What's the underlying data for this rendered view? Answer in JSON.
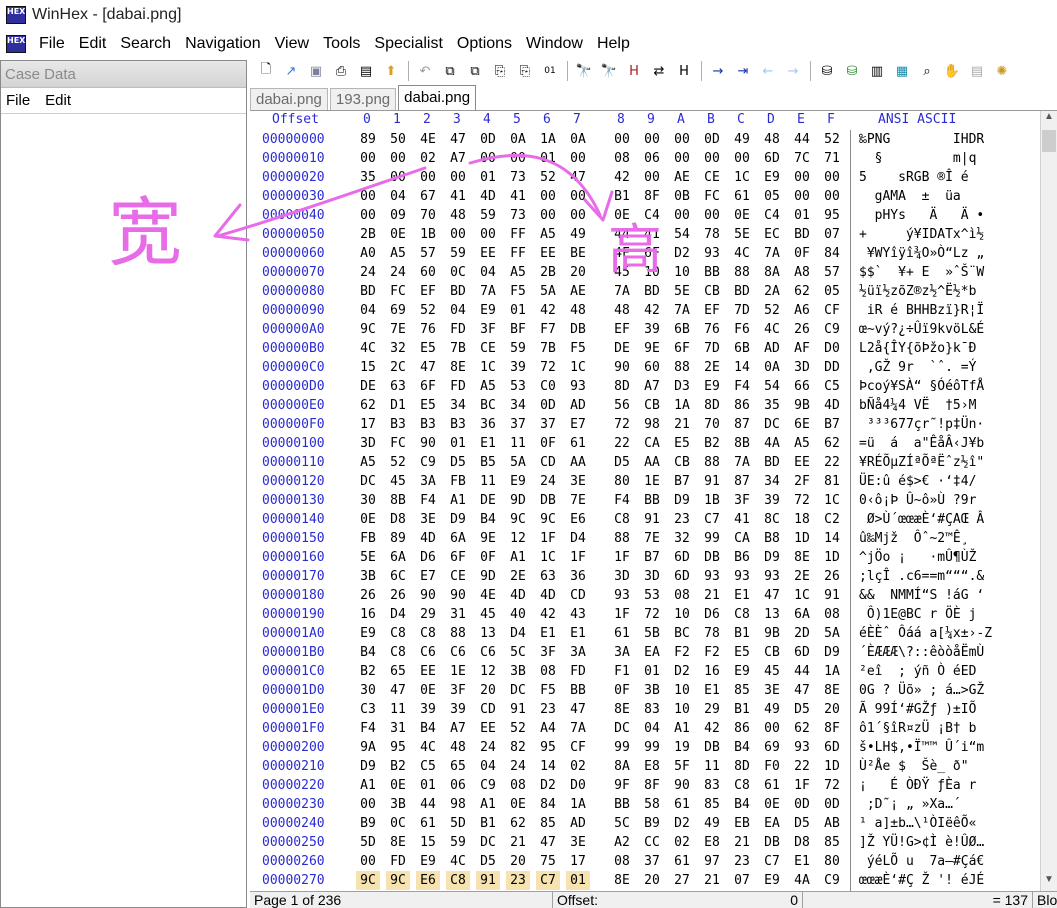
{
  "window": {
    "title": "WinHex - [dabai.png]",
    "logo": "HEX"
  },
  "menu": [
    "File",
    "Edit",
    "Search",
    "Navigation",
    "View",
    "Tools",
    "Specialist",
    "Options",
    "Window",
    "Help"
  ],
  "case_panel": {
    "header": "Case Data",
    "menu": [
      "File",
      "Edit"
    ]
  },
  "toolbar_icons": [
    "new-file-icon",
    "open-icon",
    "save-icon",
    "print-icon",
    "properties-icon",
    "export-icon",
    "undo-icon",
    "copy-icon",
    "paste-icon",
    "search-icon",
    "replace-icon",
    "goto-icon",
    "arrow-right-icon",
    "back-icon",
    "forward-icon",
    "disk-icon",
    "calculator-icon",
    "settings-icon"
  ],
  "tabs": [
    {
      "label": "dabai.png",
      "active": false
    },
    {
      "label": "193.png",
      "active": false
    },
    {
      "label": "dabai.png",
      "active": true
    }
  ],
  "hex": {
    "offset_header": "Offset",
    "col_headers": [
      "0",
      "1",
      "2",
      "3",
      "4",
      "5",
      "6",
      "7",
      "8",
      "9",
      "A",
      "B",
      "C",
      "D",
      "E",
      "F"
    ],
    "ascii_header": "ANSI ASCII",
    "offsets": [
      "00000000",
      "00000010",
      "00000020",
      "00000030",
      "00000040",
      "00000050",
      "00000060",
      "00000070",
      "00000080",
      "00000090",
      "000000A0",
      "000000B0",
      "000000C0",
      "000000D0",
      "000000E0",
      "000000F0",
      "00000100",
      "00000110",
      "00000120",
      "00000130",
      "00000140",
      "00000150",
      "00000160",
      "00000170",
      "00000180",
      "00000190",
      "000001A0",
      "000001B0",
      "000001C0",
      "000001D0",
      "000001E0",
      "000001F0",
      "00000200",
      "00000210",
      "00000220",
      "00000230",
      "00000240",
      "00000250",
      "00000260",
      "00000270"
    ],
    "rows": [
      "89 50 4E 47 0D 0A 1A 0A 00 00 00 0D 49 48 44 52",
      "00 00 02 A7 00 00 01 00 08 06 00 00 00 6D 7C 71",
      "35 00 00 00 01 73 52 47 42 00 AE CE 1C E9 00 00",
      "00 04 67 41 4D 41 00 00 B1 8F 0B FC 61 05 00 00",
      "00 09 70 48 59 73 00 00 0E C4 00 00 0E C4 01 95",
      "2B 0E 1B 00 00 FF A5 49 44 41 54 78 5E EC BD 07",
      "A0 A5 57 59 EE FF EE BE 4F 6F D2 93 4C 7A 0F 84",
      "24 24 60 0C 04 A5 2B 20 45 10 10 BB 88 8A A8 57",
      "BD FC EF BD 7A F5 5A AE 7A BD 5E CB BD 2A 62 05",
      "04 69 52 04 E9 01 42 48 48 42 7A EF 7D 52 A6 CF",
      "9C 7E 76 FD 3F BF F7 DB EF 39 6B 76 F6 4C 26 C9",
      "4C 32 E5 7B CE 59 7B F5 DE 9E 6F 7D 6B AD AF D0",
      "15 2C 47 8E 1C 39 72 1C 90 60 88 2E 14 0A 3D DD",
      "DE 63 6F FD A5 53 C0 93 8D A7 D3 E9 F4 54 66 C5",
      "62 D1 E5 34 BC 34 0D AD 56 CB 1A 8D 86 35 9B 4D",
      "17 B3 B3 B3 36 37 37 E7 72 98 21 70 87 DC 6E B7",
      "3D FC 90 01 E1 11 0F 61 22 CA E5 B2 8B 4A A5 62",
      "A5 52 C9 D5 B5 5A CD AA D5 AA CB 88 7A BD EE 22",
      "DC 45 3A FB 11 E9 24 3E 80 1E B7 91 87 34 2F 81",
      "30 8B F4 A1 DE 9D DB 7E F4 BB D9 1B 3F 39 72 1C",
      "0E D8 3E D9 B4 9C 9C E6 C8 91 23 C7 41 8C 18 C2",
      "FB 89 4D 6A 9E 12 1F D4 88 7E 32 99 CA B8 1D 14",
      "5E 6A D6 6F 0F A1 1C 1F 1F B7 6D DB B6 D9 8E 1D",
      "3B 6C E7 CE 9D 2E 63 36 3D 3D 6D 93 93 93 2E 26",
      "26 26 90 90 4E 4D 4D CD 93 53 08 21 E1 47 1C 91",
      "16 D4 29 31 45 40 42 43 1F 72 10 D6 C8 13 6A 08",
      "E9 C8 C8 88 13 D4 E1 E1 61 5B BC 78 B1 9B 2D 5A",
      "B4 C8 C6 C6 C6 5C 3F 3A 3A EA F2 F2 E5 CB 6D D9",
      "B2 65 EE 1E 12 3B 08 FD F1 01 D2 16 E9 45 44 1A",
      "30 47 0E 3F 20 DC F5 BB 0F 3B 10 E1 85 3E 47 8E",
      "C3 11 39 39 CD 91 23 47 8E 83 10 29 B1 49 D5 20",
      "F4 31 B4 A7 EE 52 A4 7A DC 04 A1 42 86 00 62 8F",
      "9A 95 4C 48 24 82 95 CF 99 99 19 DB B4 69 93 6D",
      "D9 B2 C5 65 04 24 14 02 8A E8 5F 11 8D F0 22 1D",
      "A1 0E 01 06 C9 08 D2 D0 9F 8F 90 83 C8 61 1F 72",
      "00 3B 44 98 A1 0E 84 1A BB 58 61 85 B4 0E 0D 0D",
      "B9 0C 61 5D B1 62 85 AD 5C B9 D2 49 EB EA D5 AB",
      "5D 8E 15 59 DC 21 47 3E A2 CC 02 E8 21 DB D8 85",
      "00 FD E9 4C D5 20 75 17 08 37 61 97 23 C7 E1 80",
      "9C 9C E6 C8 91 23 C7 01 8E 20 27 21 07 E9 4A C9"
    ],
    "ascii": [
      "‰PNG        IHDR",
      "  §         m|q",
      "5    sRGB ®Î é",
      "  gAMA  ±  üa",
      "  pHYs   Ä   Ä •",
      "+     ý¥IDATx^ì½",
      " ¥WYîÿî¾O»Ò“Lz „",
      "$$`  ¥+ E  »ˆŠ¨W",
      "½üï½zõZ®z½^Ë½*b",
      " iR é BHHBzï}R¦Ï",
      "œ~vý?¿÷Ûï9kvöL&É",
      "L2å{ÎY{õÞžo}k­¯Ð",
      " ,GŽ 9r  `ˆ. =Ý",
      "Þcoý¥SÀ“ §ÓéôTfÅ",
      "bÑå4¼4 ­VË  †5›M",
      " ³³³677çr˜!p‡Ün·",
      "=ü  á  a\"ÊåÂ‹J¥b",
      "¥RÉÕµZÍªÕªËˆz½î\"",
      "ÜE:û é$>€ ·‘‡4/",
      "0‹ô¡Þ Û~ô»Ù ?9r",
      " Ø>Ù´œœæÈ‘#ÇAŒ Â",
      "û‰Mjž  Ôˆ~2™Ê¸",
      "^jÖo ¡   ·mÛ¶ÙŽ",
      ";lçÎ .c6==m“““.&",
      "&&  NMMÍ“S !áG ‘",
      " Ô)1E@BC r ÖÈ j",
      "éÈÈˆ Ôáá a[¼x±›-Z",
      "´ÈÆÆÆ\\?::êòòåËmÙ",
      "²eî  ; ýñ Ò éED",
      "0G ? Üõ» ; á…>GŽ",
      "Ã 99Í‘#GŽƒ )±IÕ",
      "ô1´§îR¤zÜ ¡B† b",
      "š•LH$‚•Ï™™ Û´i“m",
      "Ù²Åe $  Šè_ ð\"",
      "¡   É ÒÐŸ ƒÈa r",
      " ;D˜¡ „ »Xa…´",
      "¹ a]±b…­\\¹ÒIëêÕ«",
      "]Ž YÜ!G>¢Ì è!ÛØ…",
      " ýéLÕ u  7a—#Çá€",
      "œœæÈ‘#Ç Ž '! éJÉ"
    ],
    "highlight_row": 39,
    "highlight_start": 0,
    "highlight_end": 7
  },
  "annotations": {
    "width_label": "宽",
    "height_label": "高",
    "ink_color": "#e86be8"
  },
  "status": {
    "page": "Page 1 of 236",
    "offset_label": "Offset:",
    "offset_value": "0",
    "equals": "= 137",
    "block": "Blo"
  }
}
